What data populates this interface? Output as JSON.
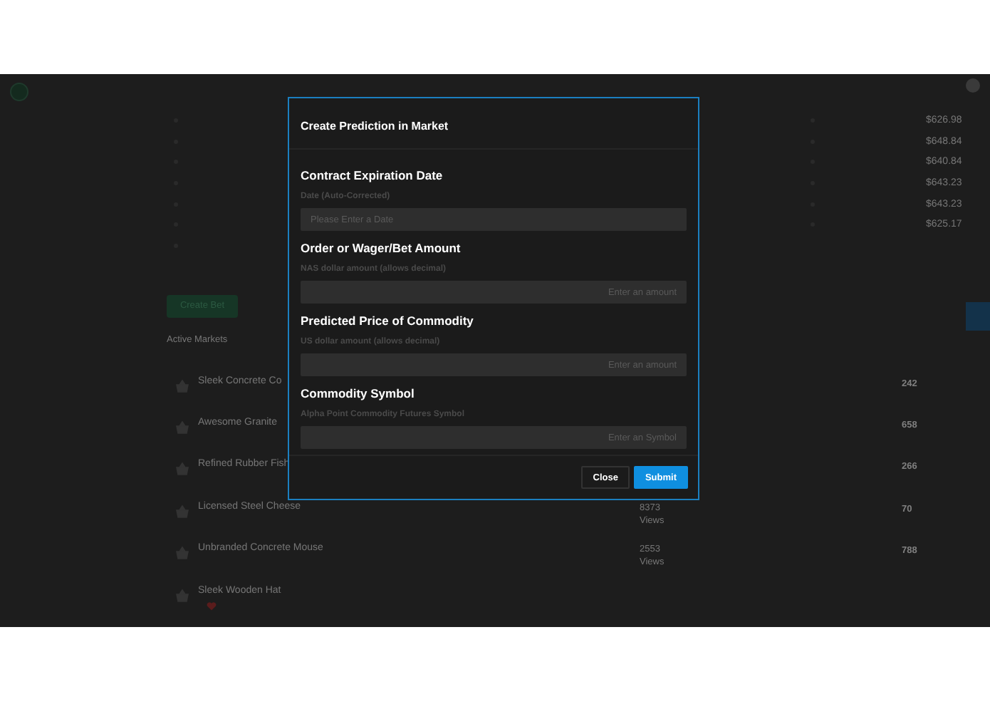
{
  "background": {
    "prices": [
      "$626.98",
      "$648.84",
      "$640.84",
      "$643.23",
      "$643.23",
      "$625.17"
    ],
    "create_button": "Create Bet",
    "section_title": "Active Markets",
    "markets": [
      {
        "name": "Sleek Concrete Co",
        "count": "242"
      },
      {
        "name": "Awesome Granite",
        "count": "658"
      },
      {
        "name": "Refined Rubber Fish",
        "count": "266"
      },
      {
        "name": "Licensed Steel Cheese",
        "views": "8373 Views",
        "count": "70"
      },
      {
        "name": "Unbranded Concrete Mouse",
        "views": "2553 Views",
        "count": "788"
      },
      {
        "name": "Sleek Wooden Hat"
      }
    ]
  },
  "modal": {
    "title": "Create Prediction in Market",
    "fields": [
      {
        "title": "Contract Expiration Date",
        "hint": "Date (Auto-Corrected)",
        "placeholder": "Please Enter a Date",
        "kind": "date"
      },
      {
        "title": "Order or Wager/Bet Amount",
        "hint": "NAS dollar amount (allows decimal)",
        "placeholder": "Enter an amount",
        "kind": "amount"
      },
      {
        "title": "Predicted Price of Commodity",
        "hint": "US dollar amount (allows decimal)",
        "placeholder": "Enter an amount",
        "kind": "amount"
      },
      {
        "title": "Commodity Symbol",
        "hint": "Alpha Point Commodity Futures Symbol",
        "placeholder": "Enter an Symbol",
        "kind": "symbol"
      }
    ],
    "buttons": [
      {
        "label": "Close",
        "kind": "secondary"
      },
      {
        "label": "Submit",
        "kind": "primary"
      }
    ]
  }
}
